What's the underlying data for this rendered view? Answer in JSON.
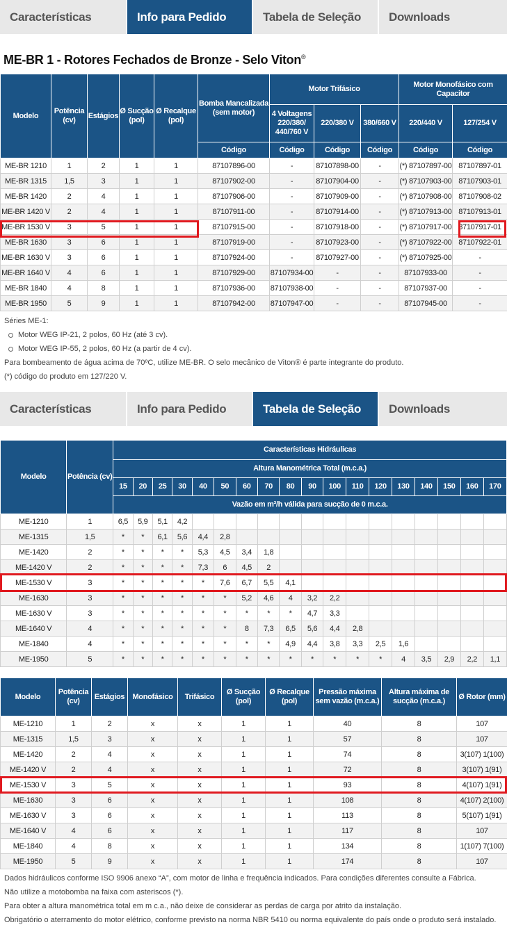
{
  "tabs": [
    "Características",
    "Info para Pedido",
    "Tabela de Seleção",
    "Downloads"
  ],
  "section_title": "ME-BR 1 - Rotores Fechados de Bronze - Selo Viton",
  "section_title_mark": "®",
  "order_table": {
    "headers": {
      "modelo": "Modelo",
      "potencia": "Potência (cv)",
      "estagios": "Estágios",
      "succao": "Ø Sucção (pol)",
      "recalque": "Ø Recalque (pol)",
      "bomba": "Bomba Mancalizada (sem motor)",
      "trifasico": "Motor Trifásico",
      "monofasico": "Motor Monofásico com Capacitor",
      "v4": "4 Voltagens 220/380/ 440/760 V",
      "v220_380": "220/380 V",
      "v380_660": "380/660 V",
      "v220_440": "220/440 V",
      "v127_254": "127/254 V",
      "codigo": "Código"
    },
    "rows": [
      [
        "ME-BR 1210",
        "1",
        "2",
        "1",
        "1",
        "87107896-00",
        "-",
        "87107898-00",
        "-",
        "(*) 87107897-00",
        "87107897-01"
      ],
      [
        "ME-BR 1315",
        "1,5",
        "3",
        "1",
        "1",
        "87107902-00",
        "-",
        "87107904-00",
        "-",
        "(*) 87107903-00",
        "87107903-01"
      ],
      [
        "ME-BR 1420",
        "2",
        "4",
        "1",
        "1",
        "87107906-00",
        "-",
        "87107909-00",
        "-",
        "(*) 87107908-00",
        "87107908-02"
      ],
      [
        "ME-BR 1420 V",
        "2",
        "4",
        "1",
        "1",
        "87107911-00",
        "-",
        "87107914-00",
        "-",
        "(*) 87107913-00",
        "87107913-01"
      ],
      [
        "ME-BR 1530 V",
        "3",
        "5",
        "1",
        "1",
        "87107915-00",
        "-",
        "87107918-00",
        "-",
        "(*) 87107917-00",
        "87107917-01"
      ],
      [
        "ME-BR 1630",
        "3",
        "6",
        "1",
        "1",
        "87107919-00",
        "-",
        "87107923-00",
        "-",
        "(*) 87107922-00",
        "87107922-01"
      ],
      [
        "ME-BR 1630 V",
        "3",
        "6",
        "1",
        "1",
        "87107924-00",
        "-",
        "87107927-00",
        "-",
        "(*) 87107925-00",
        "-"
      ],
      [
        "ME-BR 1640 V",
        "4",
        "6",
        "1",
        "1",
        "87107929-00",
        "87107934-00",
        "-",
        "-",
        "87107933-00",
        "-"
      ],
      [
        "ME-BR 1840",
        "4",
        "8",
        "1",
        "1",
        "87107936-00",
        "87107938-00",
        "-",
        "-",
        "87107937-00",
        "-"
      ],
      [
        "ME-BR 1950",
        "5",
        "9",
        "1",
        "1",
        "87107942-00",
        "87107947-00",
        "-",
        "-",
        "87107945-00",
        "-"
      ]
    ]
  },
  "order_notes": {
    "series": "Séries ME-1:",
    "bullets": [
      "Motor WEG IP-21, 2 polos, 60 Hz (até 3 cv).",
      "Motor WEG IP-55, 2 polos, 60 Hz (a partir de 4 cv)."
    ],
    "line1": "Para bombeamento de água acima de 70ºC, utilize ME-BR. O selo mecânico de Viton® é parte integrante do produto.",
    "line2": "(*) código do produto em 127/220 V."
  },
  "hydraulic_table": {
    "headers": {
      "modelo": "Modelo",
      "potencia": "Potência (cv)",
      "caracteristicas": "Características Hidráulicas",
      "altura": "Altura Manométrica Total (m.c.a.)",
      "vazao": "Vazão em m³/h válida para sucção de 0 m.c.a."
    },
    "heights": [
      "15",
      "20",
      "25",
      "30",
      "40",
      "50",
      "60",
      "70",
      "80",
      "90",
      "100",
      "110",
      "120",
      "130",
      "140",
      "150",
      "160",
      "170"
    ],
    "rows": [
      {
        "model": "ME-1210",
        "power": "1",
        "values": [
          "6,5",
          "5,9",
          "5,1",
          "4,2",
          "",
          "",
          "",
          "",
          "",
          "",
          "",
          "",
          "",
          "",
          "",
          "",
          "",
          ""
        ]
      },
      {
        "model": "ME-1315",
        "power": "1,5",
        "values": [
          "*",
          "*",
          "6,1",
          "5,6",
          "4,4",
          "2,8",
          "",
          "",
          "",
          "",
          "",
          "",
          "",
          "",
          "",
          "",
          "",
          ""
        ]
      },
      {
        "model": "ME-1420",
        "power": "2",
        "values": [
          "*",
          "*",
          "*",
          "*",
          "5,3",
          "4,5",
          "3,4",
          "1,8",
          "",
          "",
          "",
          "",
          "",
          "",
          "",
          "",
          "",
          ""
        ]
      },
      {
        "model": "ME-1420 V",
        "power": "2",
        "values": [
          "*",
          "*",
          "*",
          "*",
          "7,3",
          "6",
          "4,5",
          "2",
          "",
          "",
          "",
          "",
          "",
          "",
          "",
          "",
          "",
          ""
        ]
      },
      {
        "model": "ME-1530 V",
        "power": "3",
        "values": [
          "*",
          "*",
          "*",
          "*",
          "*",
          "7,6",
          "6,7",
          "5,5",
          "4,1",
          "",
          "",
          "",
          "",
          "",
          "",
          "",
          "",
          ""
        ]
      },
      {
        "model": "ME-1630",
        "power": "3",
        "values": [
          "*",
          "*",
          "*",
          "*",
          "*",
          "*",
          "5,2",
          "4,6",
          "4",
          "3,2",
          "2,2",
          "",
          "",
          "",
          "",
          "",
          "",
          ""
        ]
      },
      {
        "model": "ME-1630 V",
        "power": "3",
        "values": [
          "*",
          "*",
          "*",
          "*",
          "*",
          "*",
          "*",
          "*",
          "*",
          "4,7",
          "3,3",
          "",
          "",
          "",
          "",
          "",
          "",
          ""
        ]
      },
      {
        "model": "ME-1640 V",
        "power": "4",
        "values": [
          "*",
          "*",
          "*",
          "*",
          "*",
          "*",
          "8",
          "7,3",
          "6,5",
          "5,6",
          "4,4",
          "2,8",
          "",
          "",
          "",
          "",
          "",
          ""
        ]
      },
      {
        "model": "ME-1840",
        "power": "4",
        "values": [
          "*",
          "*",
          "*",
          "*",
          "*",
          "*",
          "*",
          "*",
          "4,9",
          "4,4",
          "3,8",
          "3,3",
          "2,5",
          "1,6",
          "",
          "",
          "",
          ""
        ]
      },
      {
        "model": "ME-1950",
        "power": "5",
        "values": [
          "*",
          "*",
          "*",
          "*",
          "*",
          "*",
          "*",
          "*",
          "*",
          "*",
          "*",
          "*",
          "*",
          "4",
          "3,5",
          "2,9",
          "2,2",
          "1,1"
        ]
      }
    ]
  },
  "spec_table": {
    "headers": [
      "Modelo",
      "Potência (cv)",
      "Estágios",
      "Monofásico",
      "Trifásico",
      "Ø Sucção (pol)",
      "Ø Recalque (pol)",
      "Pressão máxima sem vazão (m.c.a.)",
      "Altura máxima de sucção (m.c.a.)",
      "Ø Rotor (mm)"
    ],
    "rows": [
      [
        "ME-1210",
        "1",
        "2",
        "x",
        "x",
        "1",
        "1",
        "40",
        "8",
        "107"
      ],
      [
        "ME-1315",
        "1,5",
        "3",
        "x",
        "x",
        "1",
        "1",
        "57",
        "8",
        "107"
      ],
      [
        "ME-1420",
        "2",
        "4",
        "x",
        "x",
        "1",
        "1",
        "74",
        "8",
        "3(107) 1(100)"
      ],
      [
        "ME-1420 V",
        "2",
        "4",
        "x",
        "x",
        "1",
        "1",
        "72",
        "8",
        "3(107) 1(91)"
      ],
      [
        "ME-1530 V",
        "3",
        "5",
        "x",
        "x",
        "1",
        "1",
        "93",
        "8",
        "4(107) 1(91)"
      ],
      [
        "ME-1630",
        "3",
        "6",
        "x",
        "x",
        "1",
        "1",
        "108",
        "8",
        "4(107) 2(100)"
      ],
      [
        "ME-1630 V",
        "3",
        "6",
        "x",
        "x",
        "1",
        "1",
        "113",
        "8",
        "5(107) 1(91)"
      ],
      [
        "ME-1640 V",
        "4",
        "6",
        "x",
        "x",
        "1",
        "1",
        "117",
        "8",
        "107"
      ],
      [
        "ME-1840",
        "4",
        "8",
        "x",
        "x",
        "1",
        "1",
        "134",
        "8",
        "1(107) 7(100)"
      ],
      [
        "ME-1950",
        "5",
        "9",
        "x",
        "x",
        "1",
        "1",
        "174",
        "8",
        "107"
      ]
    ]
  },
  "footer_notes": [
    "Dados hidráulicos conforme ISO 9906 anexo “A”, com motor de linha e frequência indicados. Para condições diferentes consulte a Fábrica.",
    "Não utilize a motobomba na faixa com asteriscos (*).",
    "Para obter a altura manométrica total em m c.a., não deixe de considerar as perdas de carga por atrito da instalação.",
    "Obrigatório o aterramento do motor elétrico, conforme previsto na norma NBR 5410 ou norma equivalente do país onde o produto será instalado."
  ],
  "colors": {
    "header_blue": "#1b5486",
    "highlight_red": "#e0191f",
    "tab_inactive": "#e8e8e8"
  }
}
